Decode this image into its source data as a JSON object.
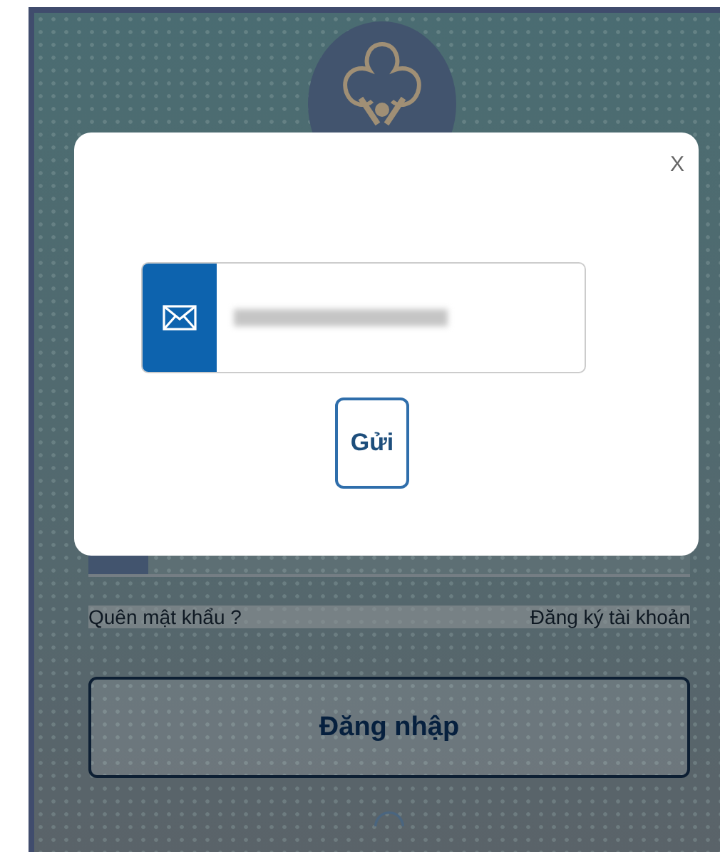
{
  "login_screen": {
    "links": [
      {
        "label": "Quên mật khẩu ?"
      },
      {
        "label": "Đăng ký tài khoản"
      }
    ],
    "login_button": "Đăng nhập"
  },
  "dialog": {
    "close": "X",
    "submit_button": "Gửi"
  }
}
